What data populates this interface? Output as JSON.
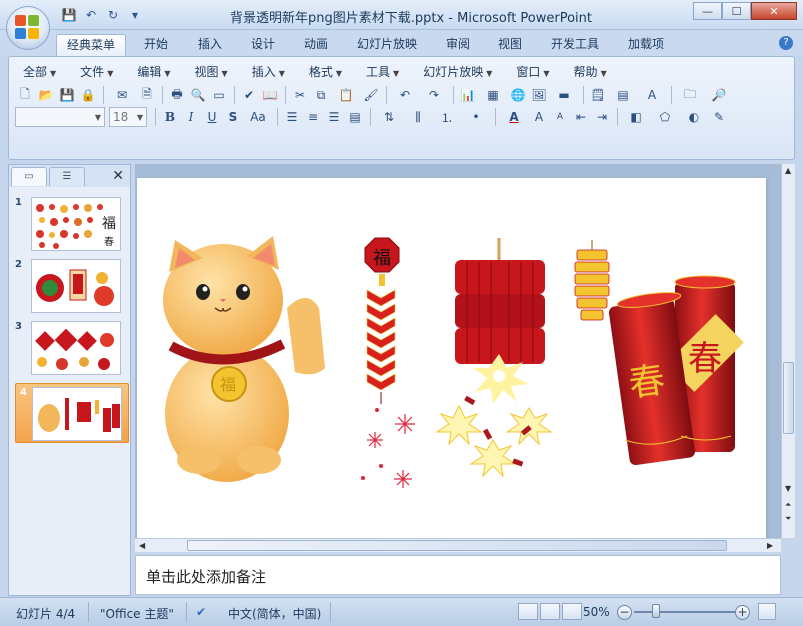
{
  "window": {
    "title": "背景透明新年png图片素材下载.pptx - Microsoft PowerPoint",
    "controls": [
      "—",
      "☐",
      "✕"
    ]
  },
  "qat": {
    "save": "💾",
    "undo": "↶",
    "redo": "↻",
    "more": "▾"
  },
  "ribbon_tabs": [
    "经典菜单",
    "开始",
    "插入",
    "设计",
    "动画",
    "幻灯片放映",
    "审阅",
    "视图",
    "开发工具",
    "加载项"
  ],
  "help": "?",
  "menus": [
    "全部",
    "文件",
    "编辑",
    "视图",
    "插入",
    "格式",
    "工具",
    "幻灯片放映",
    "窗口",
    "帮助"
  ],
  "toolbar": {
    "font_name": "",
    "font_size": "18",
    "bold": "B",
    "italic": "I",
    "underline": "U",
    "strike": "S",
    "case": "Aa",
    "font_color": "A"
  },
  "slides_pane": {
    "close": "✕",
    "thumbnails": [
      {
        "num": "1"
      },
      {
        "num": "2"
      },
      {
        "num": "3"
      },
      {
        "num": "4"
      }
    ],
    "selected": 4
  },
  "slide": {
    "cat_badge": "福",
    "lantern_char": "福",
    "scroll_char_1": "春",
    "scroll_char_2": "春"
  },
  "notes": {
    "placeholder": "单击此处添加备注"
  },
  "status": {
    "slide_info": "幻灯片 4/4",
    "theme": "\"Office 主题\"",
    "language": "中文(简体，中国)",
    "zoom": "50%",
    "zoom_level_percent": 50
  },
  "colors": {
    "ribbon_bg": "#dae6f6",
    "accent": "#f3a34b",
    "red": "#c8161d",
    "gold": "#f4c430"
  }
}
